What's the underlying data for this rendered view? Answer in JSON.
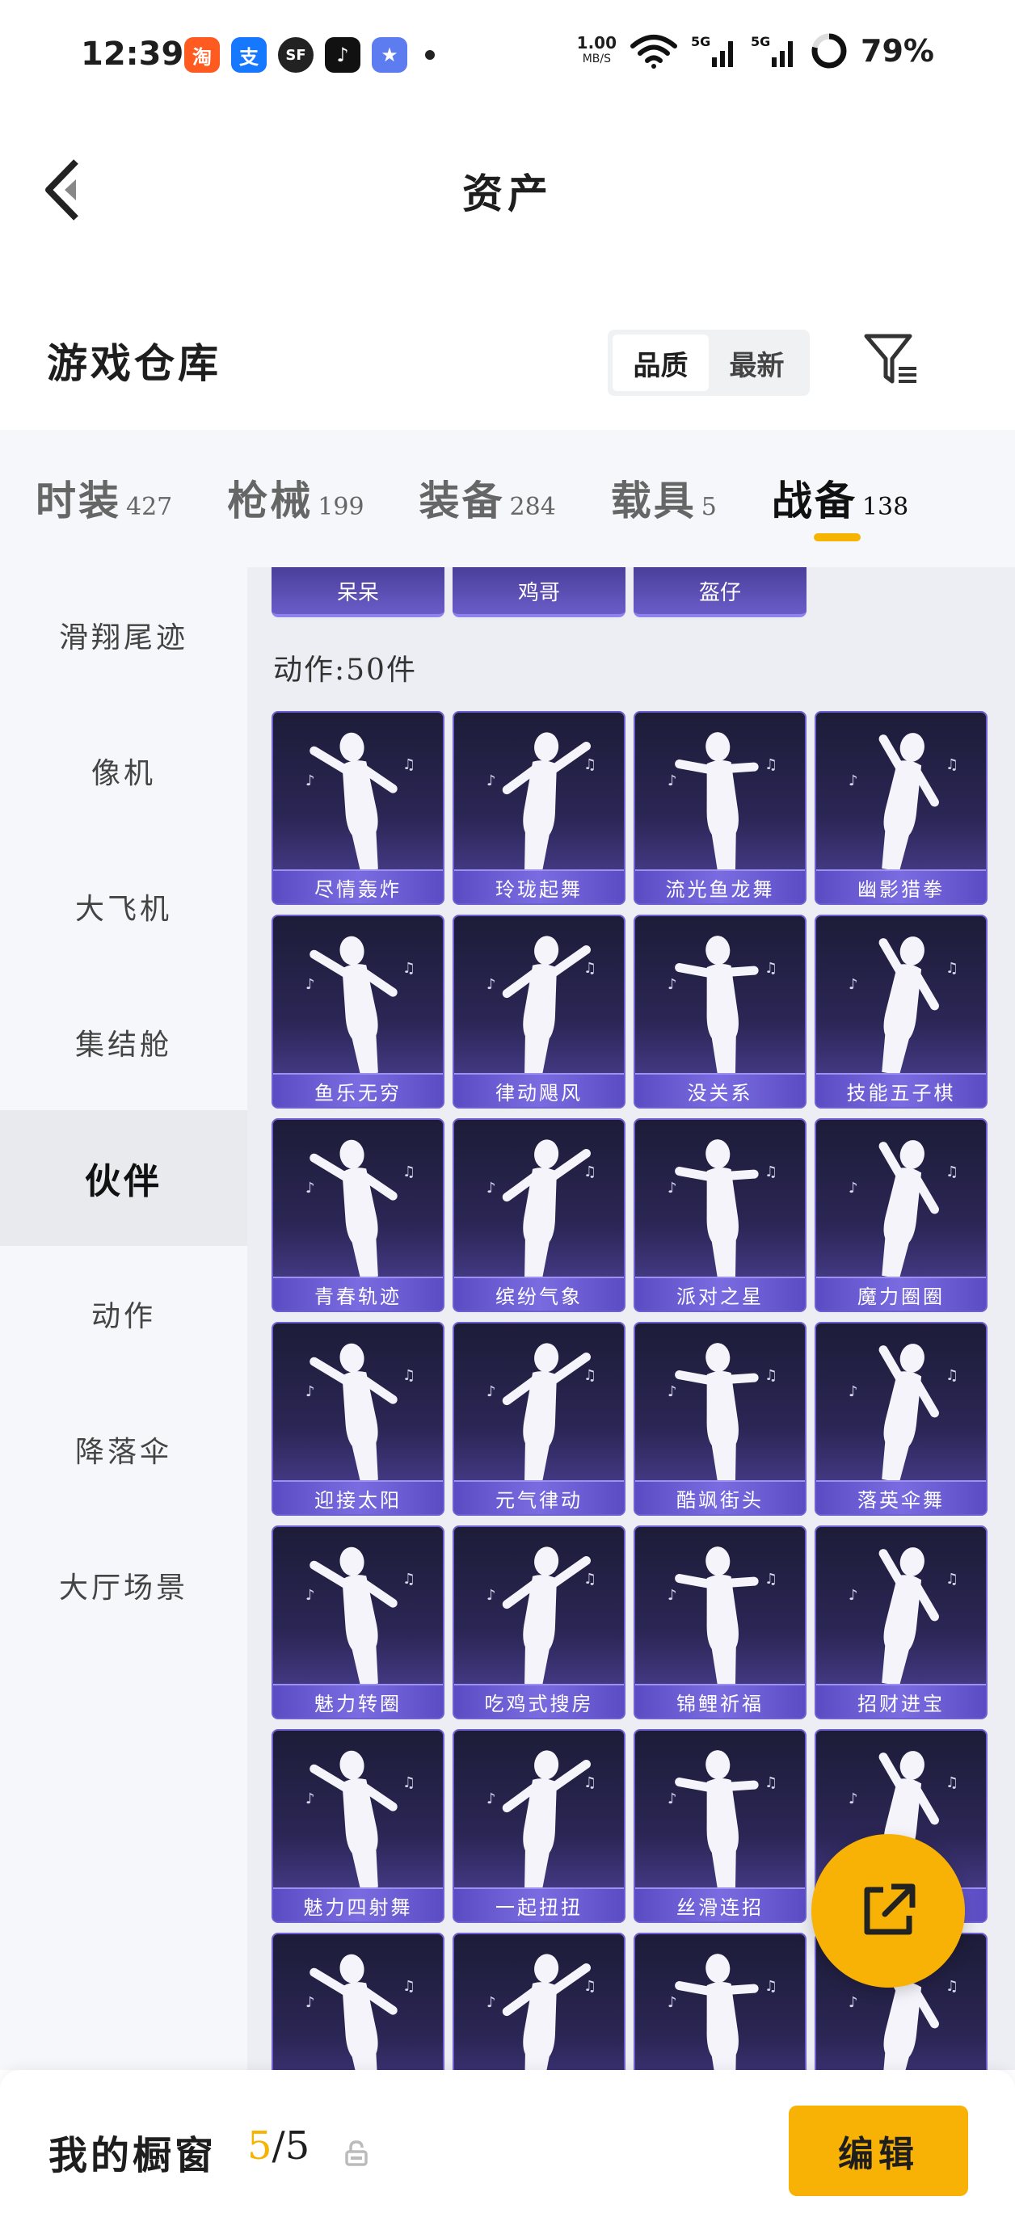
{
  "status_bar": {
    "time": "12:39",
    "apps": [
      {
        "icon": "taobao-app-icon",
        "glyph": "淘",
        "color": "#ff5a1f"
      },
      {
        "icon": "alipay-app-icon",
        "glyph": "支",
        "color": "#1677ff"
      },
      {
        "icon": "sf-express-app-icon",
        "glyph": "SF",
        "color": "#222222"
      },
      {
        "icon": "tiktok-app-icon",
        "glyph": "♪",
        "color": "#111111"
      },
      {
        "icon": "game-app-icon",
        "glyph": "★",
        "color": "#5d7cf0"
      }
    ],
    "net_speed": "1.00",
    "net_unit": "MB/S",
    "signal_1": "5G",
    "signal_2": "5G",
    "battery": "79%"
  },
  "header": {
    "title": "资产"
  },
  "warehouse": {
    "title": "游戏仓库",
    "sort_options": [
      "品质",
      "最新"
    ],
    "sort_selected": "品质"
  },
  "tabs": [
    {
      "name": "时装",
      "count": "427"
    },
    {
      "name": "枪械",
      "count": "199"
    },
    {
      "name": "装备",
      "count": "284"
    },
    {
      "name": "载具",
      "count": "5"
    },
    {
      "name": "战备",
      "count": "138",
      "active": true
    }
  ],
  "sidebar": {
    "items": [
      "滑翔尾迹",
      "像机",
      "大飞机",
      "集结舱",
      "伙伴",
      "动作",
      "降落伞",
      "大厅场景"
    ],
    "active": "伙伴"
  },
  "content": {
    "previous_row": [
      "呆呆",
      "鸡哥",
      "盔仔"
    ],
    "section_label": "动作:50件",
    "items": [
      "尽情轰炸",
      "玲珑起舞",
      "流光鱼龙舞",
      "幽影猎拳",
      "鱼乐无穷",
      "律动飓风",
      "没关系",
      "技能五子棋",
      "青春轨迹",
      "缤纷气象",
      "派对之星",
      "魔力圈圈",
      "迎接太阳",
      "元气律动",
      "酷飒街头",
      "落英伞舞",
      "魅力转圈",
      "吃鸡式搜房",
      "锦鲤祈福",
      "招财进宝",
      "魅力四射舞",
      "一起扭扭",
      "丝滑连招",
      "",
      "",
      "",
      "",
      ""
    ]
  },
  "bottom_bar": {
    "title": "我的橱窗",
    "count_current": "5",
    "count_sep_total": "/5",
    "edit_label": "编辑"
  },
  "colors": {
    "accent": "#f8b205",
    "card_bottom": "#50449e",
    "card_top": "#1d1c38"
  }
}
